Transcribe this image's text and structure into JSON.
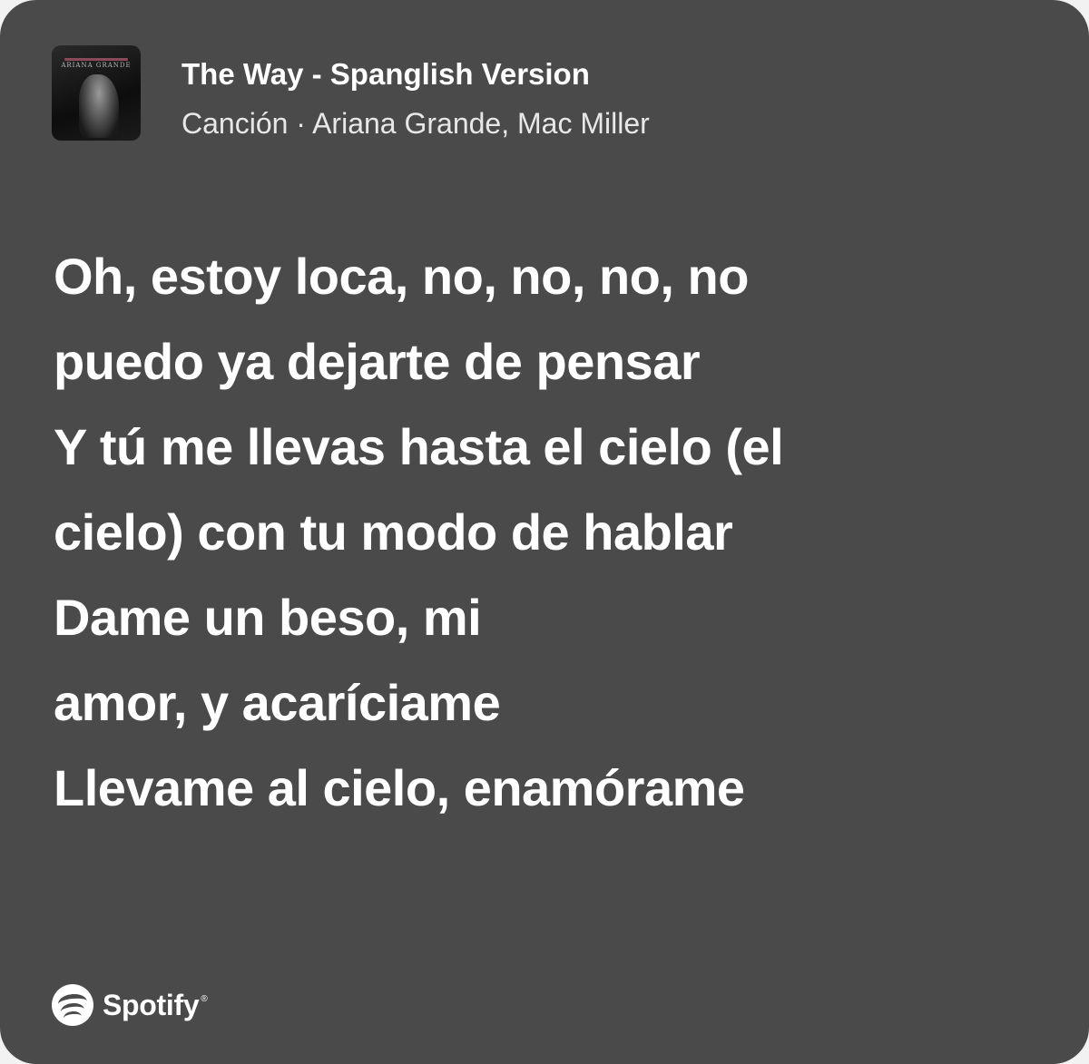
{
  "track": {
    "title": "The Way - Spanglish Version",
    "subtitle": "Canción · Ariana Grande, Mac Miller",
    "cover_artist_text": "ARIANA GRANDE"
  },
  "lyrics": [
    "Oh, estoy loca, no, no, no, no",
    "puedo ya dejarte de pensar",
    "Y tú me llevas hasta el cielo (el",
    "cielo) con tu modo de hablar",
    "Dame un beso, mi",
    "amor, y acaríciame",
    "Llevame al cielo, enamórame"
  ],
  "brand": {
    "name": "Spotify",
    "mark": "®",
    "icon": "spotify-logo-icon"
  },
  "colors": {
    "card_background": "#4a4a4a",
    "text": "#ffffff"
  }
}
